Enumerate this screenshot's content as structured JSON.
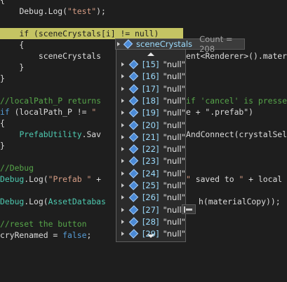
{
  "code": {
    "lines": [
      {
        "text": "{"
      },
      {
        "text": "    Debug.Log(\"test\");"
      },
      {
        "text": ""
      },
      {
        "text": "    if (sceneCrystals[i] != null)"
      },
      {
        "text": "    {"
      },
      {
        "text": "        sceneCrystals"
      },
      {
        "text": "    }"
      },
      {
        "text": "}"
      },
      {
        "text": "//localPath_P returns"
      },
      {
        "text": "if (localPath_P != \""
      },
      {
        "text": "{"
      },
      {
        "text": "    PrefabUtility.Sav"
      },
      {
        "text": "}"
      },
      {
        "text": "//Debug"
      },
      {
        "text": "Debug.Log(\"Prefab \" +"
      },
      {
        "text": "Debug.Log(AssetDatabas"
      },
      {
        "text": "//reset the button"
      },
      {
        "text": "cryRenamed = false;"
      }
    ],
    "right_fragments": {
      "line5": "ent<Renderer>().materi",
      "line8": "if 'cancel' is presse",
      "line9": "e + \".prefab\")",
      "line11": "AndConnect(crystalSel",
      "line14": "\" saved to \" + local",
      "line15": "h(materialCopy));"
    }
  },
  "tooltip": {
    "name": "sceneCrystals",
    "count": "Count = 208"
  },
  "dropdown": {
    "items": [
      {
        "index": "[15]",
        "value": "\"null\""
      },
      {
        "index": "[16]",
        "value": "\"null\""
      },
      {
        "index": "[17]",
        "value": "\"null\""
      },
      {
        "index": "[18]",
        "value": "\"null\""
      },
      {
        "index": "[19]",
        "value": "\"null\""
      },
      {
        "index": "[20]",
        "value": "\"null\""
      },
      {
        "index": "[21]",
        "value": "\"null\""
      },
      {
        "index": "[22]",
        "value": "\"null\""
      },
      {
        "index": "[23]",
        "value": "\"null\""
      },
      {
        "index": "[24]",
        "value": "\"null\""
      },
      {
        "index": "[25]",
        "value": "\"null\""
      },
      {
        "index": "[26]",
        "value": "\"null\""
      },
      {
        "index": "[27]",
        "value": "\"null\""
      },
      {
        "index": "[28]",
        "value": "\"null\""
      },
      {
        "index": "[29]",
        "value": "\"null\""
      }
    ]
  }
}
